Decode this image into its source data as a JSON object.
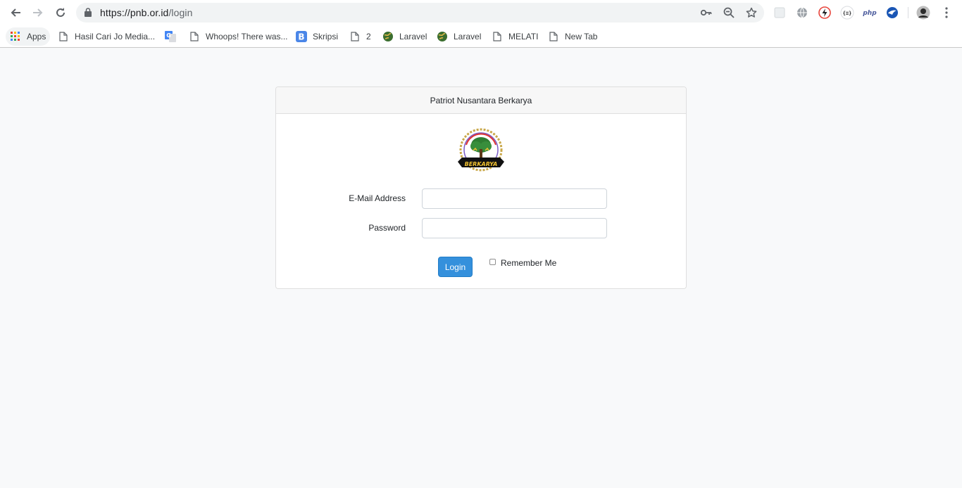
{
  "browser": {
    "url_host": "https://pnb.or.id",
    "url_path": "/login",
    "bookmarks": [
      {
        "label": "Apps",
        "icon": "apps-grid-icon"
      },
      {
        "label": "Hasil Cari Jo Media...",
        "icon": "page-icon"
      },
      {
        "label": "",
        "icon": "google-translate-icon"
      },
      {
        "label": "Whoops! There was...",
        "icon": "page-icon"
      },
      {
        "label": "Skripsi",
        "icon": "blogger-icon"
      },
      {
        "label": "2",
        "icon": "page-icon"
      },
      {
        "label": "Laravel",
        "icon": "globe-icon"
      },
      {
        "label": "Laravel",
        "icon": "globe-icon"
      },
      {
        "label": "MELATI",
        "icon": "page-icon"
      },
      {
        "label": "New Tab",
        "icon": "page-icon"
      }
    ],
    "extensions": [
      "blank-extension-icon",
      "globe-extension-icon",
      "lightning-extension-icon",
      "json-extension-icon",
      "php-extension-icon",
      "bird-extension-icon"
    ]
  },
  "login": {
    "header": "Patriot Nusantara Berkarya",
    "logo_text": "BERKARYA",
    "email_label": "E-Mail Address",
    "email_value": "",
    "password_label": "Password",
    "password_value": "",
    "login_button": "Login",
    "remember_label": "Remember Me",
    "remember_checked": false
  },
  "colors": {
    "primary": "#3490dc",
    "page_bg": "#f8f9fa"
  }
}
